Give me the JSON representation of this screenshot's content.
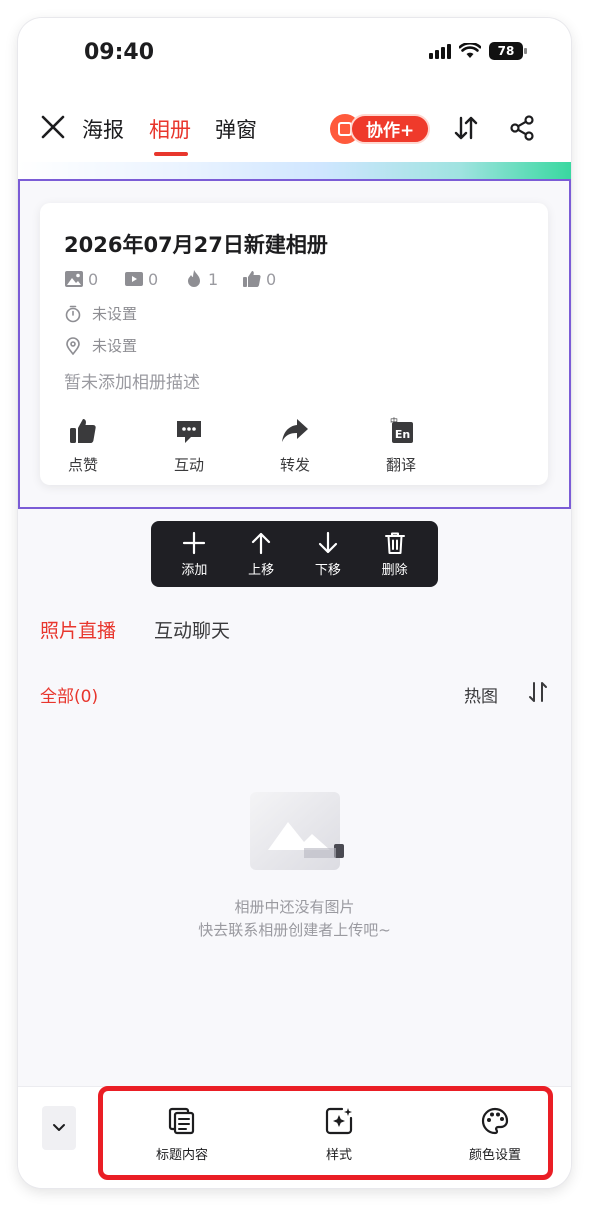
{
  "status_bar": {
    "time": "09:40",
    "battery": "78"
  },
  "nav": {
    "tabs": [
      {
        "label": "海报"
      },
      {
        "label": "相册"
      },
      {
        "label": "弹窗"
      }
    ],
    "active_tab": "相册",
    "collab_label": "协作+"
  },
  "album": {
    "title": "2026年07月27日新建相册",
    "stats": {
      "photos": "0",
      "videos": "0",
      "hot": "1",
      "likes": "0"
    },
    "time_label": "未设置",
    "location_label": "未设置",
    "description": "暂未添加相册描述",
    "actions": [
      {
        "label": "点赞",
        "icon": "thumbs-up-icon"
      },
      {
        "label": "互动",
        "icon": "chat-bubble-icon"
      },
      {
        "label": "转发",
        "icon": "share-arrow-icon"
      },
      {
        "label": "翻译",
        "icon": "translate-icon"
      }
    ]
  },
  "float_toolbar": {
    "items": [
      {
        "label": "添加",
        "icon": "plus-icon"
      },
      {
        "label": "上移",
        "icon": "arrow-up-icon"
      },
      {
        "label": "下移",
        "icon": "arrow-down-icon"
      },
      {
        "label": "删除",
        "icon": "trash-icon"
      }
    ]
  },
  "content_tabs": [
    {
      "label": "照片直播"
    },
    {
      "label": "互动聊天"
    }
  ],
  "filter": {
    "all_label": "全部(0)",
    "hot_label": "热图"
  },
  "empty_state": {
    "line1": "相册中还没有图片",
    "line2": "快去联系相册创建者上传吧~"
  },
  "bottom_toolbar": {
    "items": [
      {
        "label": "标题内容",
        "icon": "title-content-icon"
      },
      {
        "label": "样式",
        "icon": "style-sparkle-icon"
      },
      {
        "label": "颜色设置",
        "icon": "palette-icon"
      }
    ]
  },
  "colors": {
    "accent": "#e8362d",
    "selection": "#7b5cd6",
    "highlight": "#ea1e25",
    "toolbar_bg": "#1f1f24"
  }
}
